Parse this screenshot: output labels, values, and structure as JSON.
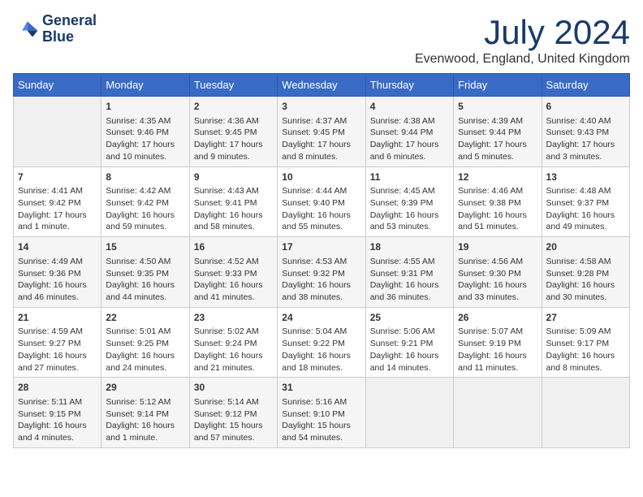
{
  "header": {
    "logo_line1": "General",
    "logo_line2": "Blue",
    "month_title": "July 2024",
    "location": "Evenwood, England, United Kingdom"
  },
  "days_of_week": [
    "Sunday",
    "Monday",
    "Tuesday",
    "Wednesday",
    "Thursday",
    "Friday",
    "Saturday"
  ],
  "weeks": [
    [
      {
        "day": "",
        "sunrise": "",
        "sunset": "",
        "daylight": ""
      },
      {
        "day": "1",
        "sunrise": "Sunrise: 4:35 AM",
        "sunset": "Sunset: 9:46 PM",
        "daylight": "Daylight: 17 hours and 10 minutes."
      },
      {
        "day": "2",
        "sunrise": "Sunrise: 4:36 AM",
        "sunset": "Sunset: 9:45 PM",
        "daylight": "Daylight: 17 hours and 9 minutes."
      },
      {
        "day": "3",
        "sunrise": "Sunrise: 4:37 AM",
        "sunset": "Sunset: 9:45 PM",
        "daylight": "Daylight: 17 hours and 8 minutes."
      },
      {
        "day": "4",
        "sunrise": "Sunrise: 4:38 AM",
        "sunset": "Sunset: 9:44 PM",
        "daylight": "Daylight: 17 hours and 6 minutes."
      },
      {
        "day": "5",
        "sunrise": "Sunrise: 4:39 AM",
        "sunset": "Sunset: 9:44 PM",
        "daylight": "Daylight: 17 hours and 5 minutes."
      },
      {
        "day": "6",
        "sunrise": "Sunrise: 4:40 AM",
        "sunset": "Sunset: 9:43 PM",
        "daylight": "Daylight: 17 hours and 3 minutes."
      }
    ],
    [
      {
        "day": "7",
        "sunrise": "Sunrise: 4:41 AM",
        "sunset": "Sunset: 9:42 PM",
        "daylight": "Daylight: 17 hours and 1 minute."
      },
      {
        "day": "8",
        "sunrise": "Sunrise: 4:42 AM",
        "sunset": "Sunset: 9:42 PM",
        "daylight": "Daylight: 16 hours and 59 minutes."
      },
      {
        "day": "9",
        "sunrise": "Sunrise: 4:43 AM",
        "sunset": "Sunset: 9:41 PM",
        "daylight": "Daylight: 16 hours and 58 minutes."
      },
      {
        "day": "10",
        "sunrise": "Sunrise: 4:44 AM",
        "sunset": "Sunset: 9:40 PM",
        "daylight": "Daylight: 16 hours and 55 minutes."
      },
      {
        "day": "11",
        "sunrise": "Sunrise: 4:45 AM",
        "sunset": "Sunset: 9:39 PM",
        "daylight": "Daylight: 16 hours and 53 minutes."
      },
      {
        "day": "12",
        "sunrise": "Sunrise: 4:46 AM",
        "sunset": "Sunset: 9:38 PM",
        "daylight": "Daylight: 16 hours and 51 minutes."
      },
      {
        "day": "13",
        "sunrise": "Sunrise: 4:48 AM",
        "sunset": "Sunset: 9:37 PM",
        "daylight": "Daylight: 16 hours and 49 minutes."
      }
    ],
    [
      {
        "day": "14",
        "sunrise": "Sunrise: 4:49 AM",
        "sunset": "Sunset: 9:36 PM",
        "daylight": "Daylight: 16 hours and 46 minutes."
      },
      {
        "day": "15",
        "sunrise": "Sunrise: 4:50 AM",
        "sunset": "Sunset: 9:35 PM",
        "daylight": "Daylight: 16 hours and 44 minutes."
      },
      {
        "day": "16",
        "sunrise": "Sunrise: 4:52 AM",
        "sunset": "Sunset: 9:33 PM",
        "daylight": "Daylight: 16 hours and 41 minutes."
      },
      {
        "day": "17",
        "sunrise": "Sunrise: 4:53 AM",
        "sunset": "Sunset: 9:32 PM",
        "daylight": "Daylight: 16 hours and 38 minutes."
      },
      {
        "day": "18",
        "sunrise": "Sunrise: 4:55 AM",
        "sunset": "Sunset: 9:31 PM",
        "daylight": "Daylight: 16 hours and 36 minutes."
      },
      {
        "day": "19",
        "sunrise": "Sunrise: 4:56 AM",
        "sunset": "Sunset: 9:30 PM",
        "daylight": "Daylight: 16 hours and 33 minutes."
      },
      {
        "day": "20",
        "sunrise": "Sunrise: 4:58 AM",
        "sunset": "Sunset: 9:28 PM",
        "daylight": "Daylight: 16 hours and 30 minutes."
      }
    ],
    [
      {
        "day": "21",
        "sunrise": "Sunrise: 4:59 AM",
        "sunset": "Sunset: 9:27 PM",
        "daylight": "Daylight: 16 hours and 27 minutes."
      },
      {
        "day": "22",
        "sunrise": "Sunrise: 5:01 AM",
        "sunset": "Sunset: 9:25 PM",
        "daylight": "Daylight: 16 hours and 24 minutes."
      },
      {
        "day": "23",
        "sunrise": "Sunrise: 5:02 AM",
        "sunset": "Sunset: 9:24 PM",
        "daylight": "Daylight: 16 hours and 21 minutes."
      },
      {
        "day": "24",
        "sunrise": "Sunrise: 5:04 AM",
        "sunset": "Sunset: 9:22 PM",
        "daylight": "Daylight: 16 hours and 18 minutes."
      },
      {
        "day": "25",
        "sunrise": "Sunrise: 5:06 AM",
        "sunset": "Sunset: 9:21 PM",
        "daylight": "Daylight: 16 hours and 14 minutes."
      },
      {
        "day": "26",
        "sunrise": "Sunrise: 5:07 AM",
        "sunset": "Sunset: 9:19 PM",
        "daylight": "Daylight: 16 hours and 11 minutes."
      },
      {
        "day": "27",
        "sunrise": "Sunrise: 5:09 AM",
        "sunset": "Sunset: 9:17 PM",
        "daylight": "Daylight: 16 hours and 8 minutes."
      }
    ],
    [
      {
        "day": "28",
        "sunrise": "Sunrise: 5:11 AM",
        "sunset": "Sunset: 9:15 PM",
        "daylight": "Daylight: 16 hours and 4 minutes."
      },
      {
        "day": "29",
        "sunrise": "Sunrise: 5:12 AM",
        "sunset": "Sunset: 9:14 PM",
        "daylight": "Daylight: 16 hours and 1 minute."
      },
      {
        "day": "30",
        "sunrise": "Sunrise: 5:14 AM",
        "sunset": "Sunset: 9:12 PM",
        "daylight": "Daylight: 15 hours and 57 minutes."
      },
      {
        "day": "31",
        "sunrise": "Sunrise: 5:16 AM",
        "sunset": "Sunset: 9:10 PM",
        "daylight": "Daylight: 15 hours and 54 minutes."
      },
      {
        "day": "",
        "sunrise": "",
        "sunset": "",
        "daylight": ""
      },
      {
        "day": "",
        "sunrise": "",
        "sunset": "",
        "daylight": ""
      },
      {
        "day": "",
        "sunrise": "",
        "sunset": "",
        "daylight": ""
      }
    ]
  ]
}
